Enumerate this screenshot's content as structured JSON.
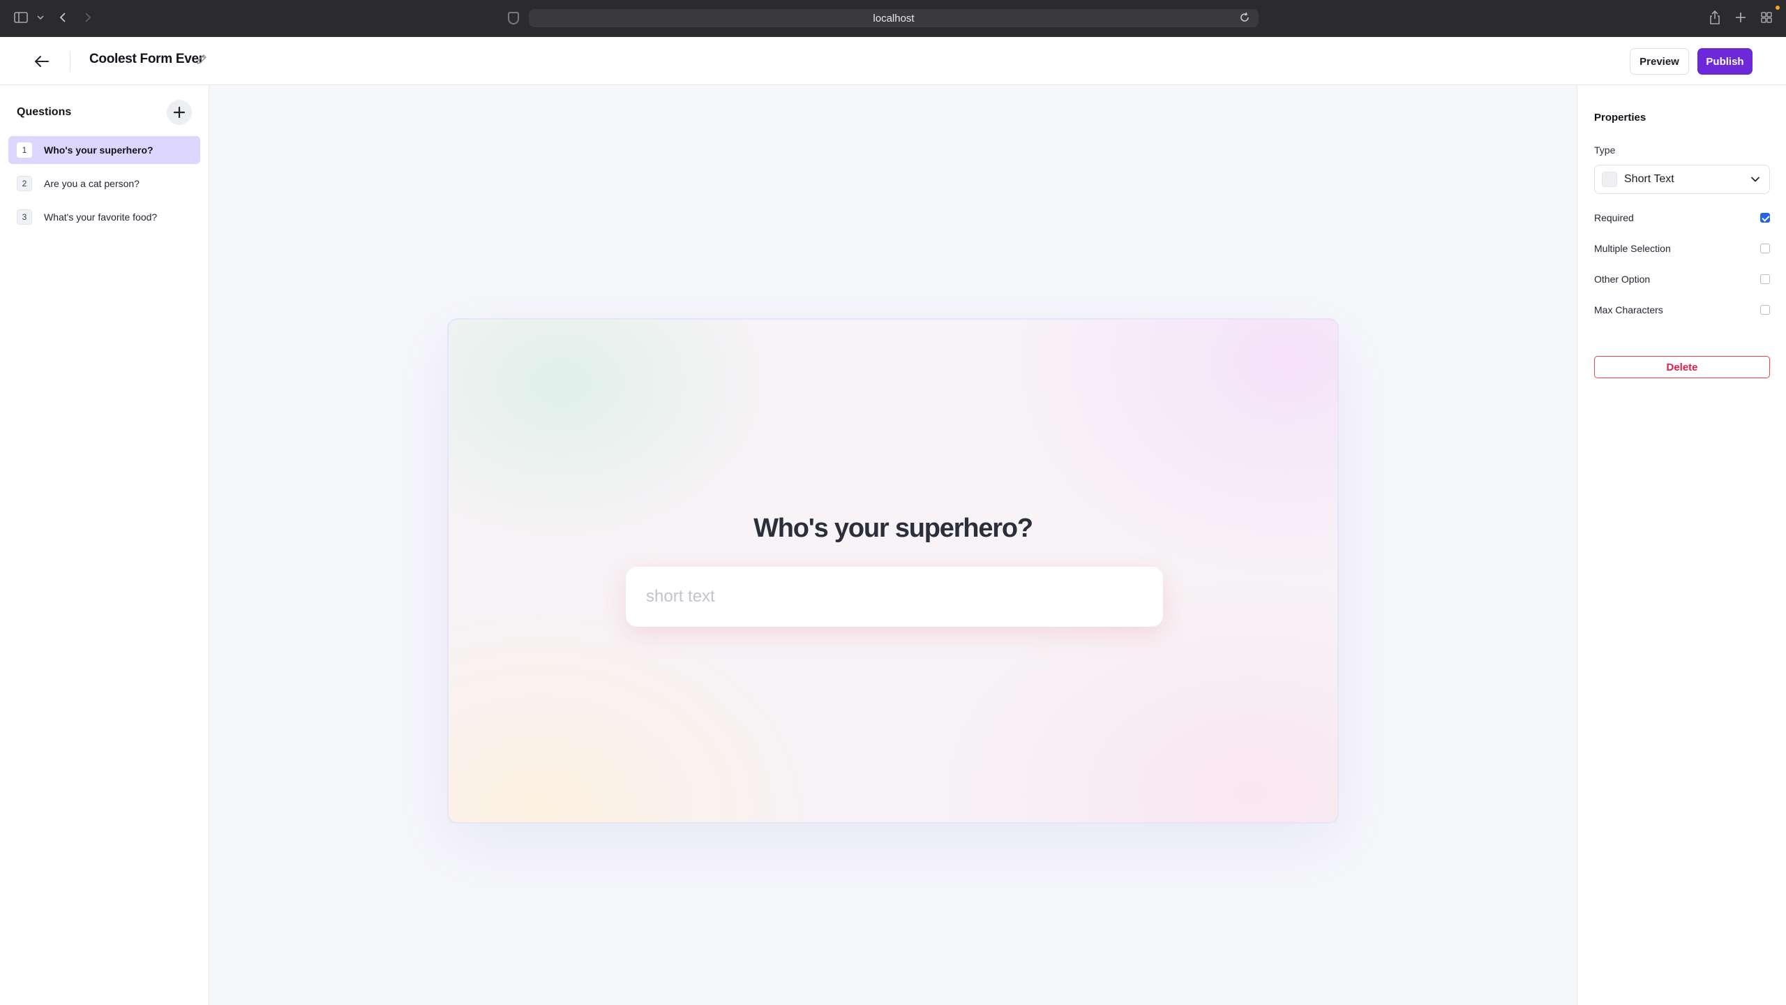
{
  "browser": {
    "url": "localhost"
  },
  "header": {
    "form_title": "Coolest Form Ever",
    "preview_label": "Preview",
    "publish_label": "Publish"
  },
  "sidebar": {
    "title": "Questions",
    "questions": [
      {
        "number": "1",
        "label": "Who's your superhero?",
        "active": true
      },
      {
        "number": "2",
        "label": "Are you a cat person?",
        "active": false
      },
      {
        "number": "3",
        "label": "What's your favorite food?",
        "active": false
      }
    ]
  },
  "canvas": {
    "question": "Who's your superhero?",
    "input_placeholder": "short text"
  },
  "properties": {
    "title": "Properties",
    "type_label": "Type",
    "type_value": "Short Text",
    "options": [
      {
        "label": "Required",
        "checked": true
      },
      {
        "label": "Multiple Selection",
        "checked": false
      },
      {
        "label": "Other Option",
        "checked": false
      },
      {
        "label": "Max Characters",
        "checked": false
      }
    ],
    "delete_label": "Delete"
  },
  "colors": {
    "accent": "#6d28d9",
    "active_question_bg": "#ddd6fe",
    "checkbox_checked": "#2563eb",
    "danger": "#e11d48"
  }
}
